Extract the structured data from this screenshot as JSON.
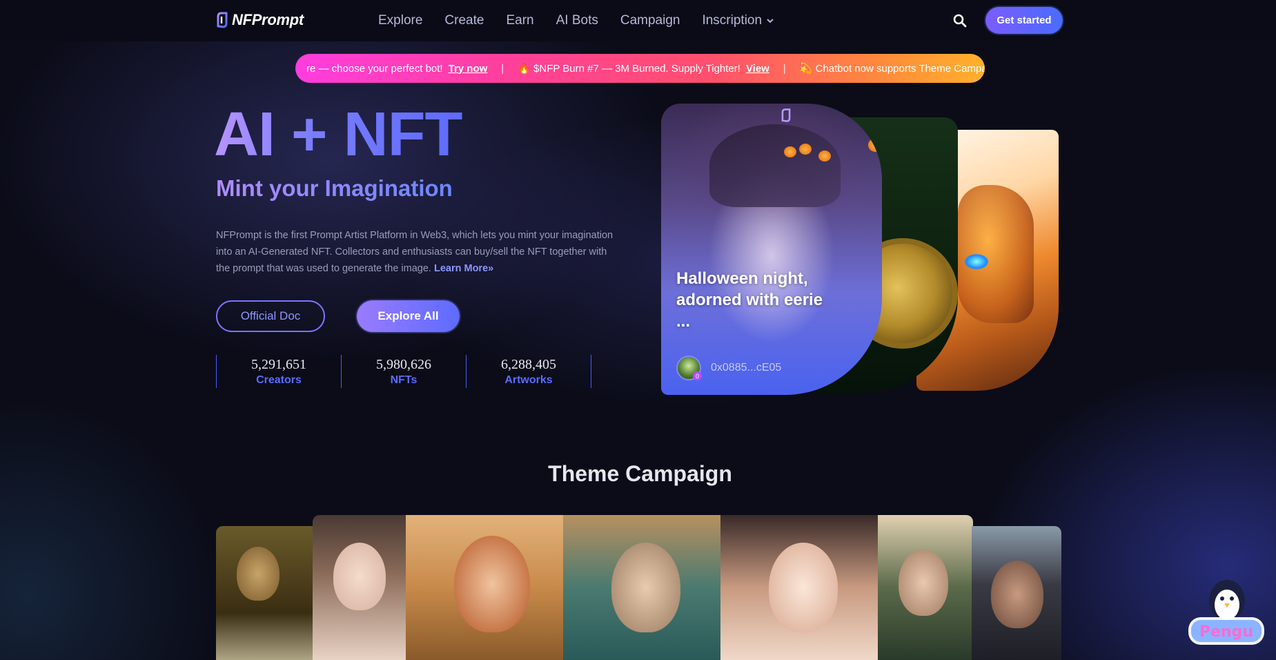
{
  "nav": {
    "logo": "NFPrompt",
    "links": [
      "Explore",
      "Create",
      "Earn",
      "AI Bots",
      "Campaign",
      "Inscription"
    ],
    "cta": "Get started"
  },
  "ticker": {
    "item1_text": "re — choose your perfect bot!",
    "item1_link": "Try now",
    "item2_text": "🔥 $NFP Burn #7 — 3M Burned. Supply Tighter!",
    "item2_link": "View",
    "item3_text": "💫 Chatbot now supports Theme Campaign"
  },
  "hero": {
    "title": "AI + NFT",
    "subtitle": "Mint your Imagination",
    "description": "NFPrompt is the first Prompt Artist Platform in Web3, which lets you mint your imagination into an AI-Generated NFT. Collectors and enthusiasts can buy/sell the NFT together with the prompt that was used to generate the image.",
    "learn_more": "Learn More»",
    "btn_doc": "Official Doc",
    "btn_explore": "Explore All",
    "stats": [
      {
        "value": "5,291,651",
        "label": "Creators"
      },
      {
        "value": "5,980,626",
        "label": "NFTs"
      },
      {
        "value": "6,288,405",
        "label": "Artworks"
      }
    ]
  },
  "featured_card": {
    "title": "Halloween night, adorned with eerie ...",
    "owner": "0x0885...cE05",
    "badge": "0"
  },
  "theme_campaign": {
    "title": "Theme Campaign"
  },
  "colors": {
    "accent": "#5d6bff",
    "background": "#0b0c18",
    "ticker_start": "#ff3ddf",
    "ticker_end": "#ffb12a"
  }
}
